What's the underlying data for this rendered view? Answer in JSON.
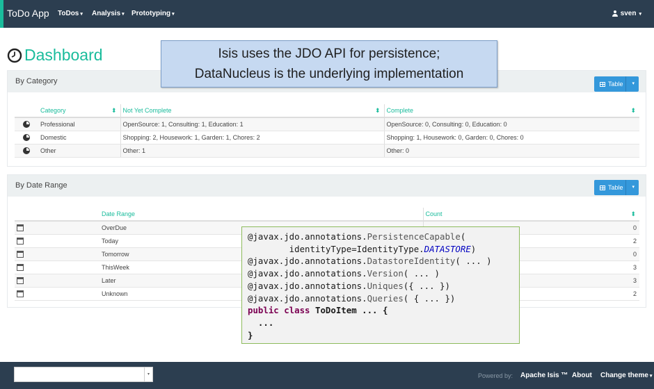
{
  "navbar": {
    "brand": "ToDo App",
    "menus": [
      "ToDos",
      "Analysis",
      "Prototyping"
    ],
    "caret": "▾",
    "user": "sven",
    "colors": {
      "bar": "#2c3e50",
      "accent": "#1abc9c"
    }
  },
  "page": {
    "title": "Dashboard",
    "title_icon": "clock-icon"
  },
  "callout": {
    "line1": "Isis uses the JDO API for persistence;",
    "line2": "DataNucleus is the underlying implementation"
  },
  "by_category": {
    "title": "By Category",
    "button": "Table",
    "columns": [
      "Category",
      "Not Yet Complete",
      "Complete"
    ],
    "rows": [
      {
        "icon": "pie-chart-icon",
        "category": "Professional",
        "not_yet_complete": "OpenSource: 1, Consulting: 1, Education: 1",
        "complete": "OpenSource: 0, Consulting: 0, Education: 0"
      },
      {
        "icon": "pie-chart-icon",
        "category": "Domestic",
        "not_yet_complete": "Shopping: 2, Housework: 1, Garden: 1, Chores: 2",
        "complete": "Shopping: 1, Housework: 0, Garden: 0, Chores: 0"
      },
      {
        "icon": "pie-chart-icon",
        "category": "Other",
        "not_yet_complete": "Other: 1",
        "complete": "Other: 0"
      }
    ]
  },
  "by_date_range": {
    "title": "By Date Range",
    "button": "Table",
    "columns": [
      "Date Range",
      "Count"
    ],
    "rows": [
      {
        "icon": "calendar-icon",
        "range": "OverDue",
        "count": "0"
      },
      {
        "icon": "calendar-icon",
        "range": "Today",
        "count": "2"
      },
      {
        "icon": "calendar-icon",
        "range": "Tomorrow",
        "count": "0"
      },
      {
        "icon": "calendar-icon",
        "range": "ThisWeek",
        "count": "3"
      },
      {
        "icon": "calendar-icon",
        "range": "Later",
        "count": "3"
      },
      {
        "icon": "calendar-icon",
        "range": "Unknown",
        "count": "2"
      }
    ]
  },
  "code": {
    "l1a": "@javax.jdo.annotations.",
    "l1b": "PersistenceCapable",
    "l1c": "(",
    "l2a": "        identityType=IdentityType.",
    "l2b": "DATASTORE",
    "l2c": ")",
    "l3a": "@javax.jdo.annotations.",
    "l3b": "DatastoreIdentity",
    "l3c": "( ... )",
    "l4a": "@javax.jdo.annotations.",
    "l4b": "Version",
    "l4c": "( ... )",
    "l5a": "@javax.jdo.annotations.",
    "l5b": "Uniques",
    "l5c": "({ ... })",
    "l6a": "@javax.jdo.annotations.",
    "l6b": "Queries",
    "l6c": "( { ... })",
    "l7a": "public class",
    "l7b": " ToDoItem ... {",
    "l8": "  ...",
    "l9": "}"
  },
  "footer": {
    "powered_by": "Powered by:",
    "product": "Apache Isis ™",
    "about": "About",
    "change_theme": "Change theme",
    "caret": "▾",
    "select_value": ""
  }
}
